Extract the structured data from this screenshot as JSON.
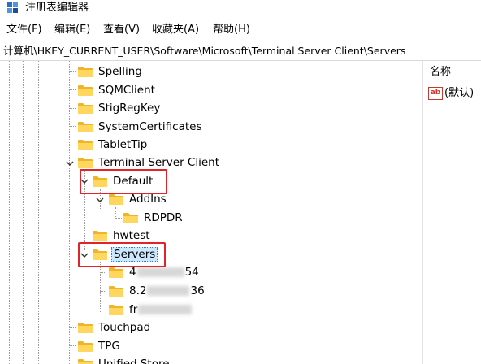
{
  "window": {
    "title": "注册表编辑器"
  },
  "menu": {
    "items": [
      "文件(F)",
      "编辑(E)",
      "查看(V)",
      "收藏夹(A)",
      "帮助(H)"
    ]
  },
  "address": {
    "path": "计算机\\HKEY_CURRENT_USER\\Software\\Microsoft\\Terminal Server Client\\Servers"
  },
  "tree": {
    "nodes": [
      {
        "label": "Spelling"
      },
      {
        "label": "SQMClient"
      },
      {
        "label": "StigRegKey"
      },
      {
        "label": "SystemCertificates"
      },
      {
        "label": "TabletTip"
      },
      {
        "label": "Terminal Server Client"
      },
      {
        "label": "Default"
      },
      {
        "label": "AddIns"
      },
      {
        "label": "RDPDR"
      },
      {
        "label": "hwtest"
      },
      {
        "label": "Servers"
      },
      {
        "label_start": "4",
        "label_end": "54"
      },
      {
        "label_start": "8.2",
        "label_end": "36"
      },
      {
        "label_start": "fr",
        "label_end": ""
      },
      {
        "label": "Touchpad"
      },
      {
        "label": "TPG"
      },
      {
        "label": "Unified Store"
      }
    ]
  },
  "values_pane": {
    "column_name": "名称",
    "values": [
      {
        "icon": "string-value-icon",
        "icon_text": "ab",
        "name": "(默认)"
      }
    ]
  },
  "colors": {
    "highlight": "#e0242a",
    "selection": "#cce8ff",
    "folder": "#f5c542"
  }
}
